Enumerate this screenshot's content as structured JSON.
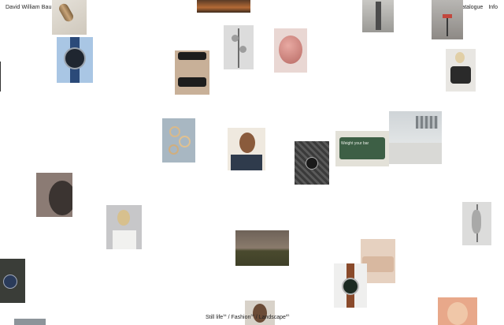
{
  "header": {
    "brand": "David William Baum"
  },
  "nav": {
    "catalogue": "Catalogue",
    "info": "Info"
  },
  "footer": {
    "still_life": "Still life",
    "still_life_count": "34",
    "fashion": "Fashion",
    "fashion_count": "39",
    "landscape": "Landscape",
    "landscape_count": "83"
  },
  "tile_caption": {
    "weight_bar": "Weight your bar"
  },
  "colors": {
    "background": "#ffffff",
    "text": "#222222"
  }
}
